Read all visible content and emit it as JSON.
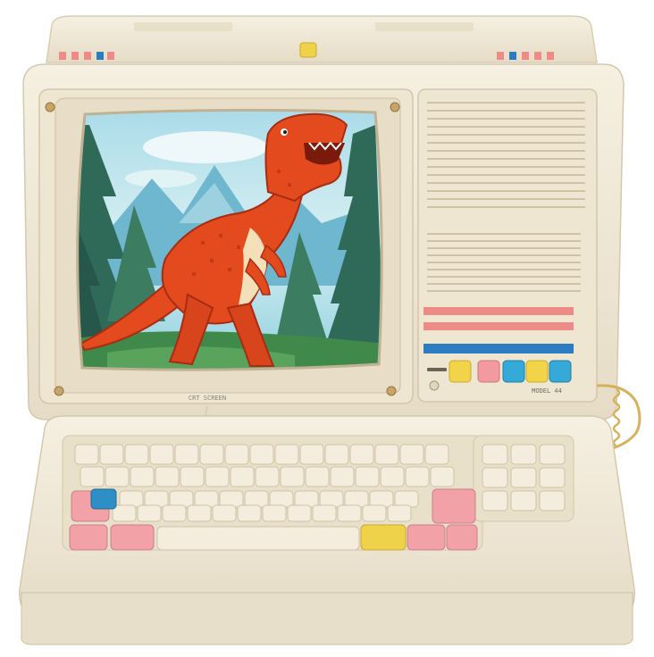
{
  "scene": {
    "subject": "retro-computer",
    "screen": {
      "label": "CRT SCREEN"
    },
    "side_panel": {
      "model_label": "MODEL 44",
      "buttons": [
        {
          "name": "yellow",
          "color": "#f2d44a"
        },
        {
          "name": "pink",
          "color": "#f29aa0"
        },
        {
          "name": "cyan",
          "color": "#35a9d8"
        },
        {
          "name": "yellow",
          "color": "#f2d44a"
        },
        {
          "name": "cyan",
          "color": "#35a9d8"
        }
      ],
      "stripes": [
        "#ef8b86",
        "#ef8b86",
        "#2b7cc0"
      ]
    },
    "colors": {
      "case": "#f2ead8",
      "case_shadow": "#ddd2ba",
      "case_dark": "#c9bda3",
      "key": "#f4edde",
      "key_pink": "#f2a2a6",
      "key_blue": "#2e8fc6",
      "key_yellow": "#f0d24a",
      "dino": "#e34a1e",
      "dino_dark": "#a82c12",
      "dino_belly": "#f4e0b8",
      "sky": "#bfe6ef",
      "mountain": "#6fb6cf",
      "tree": "#2f6a58",
      "grass": "#3f8a4a"
    }
  }
}
